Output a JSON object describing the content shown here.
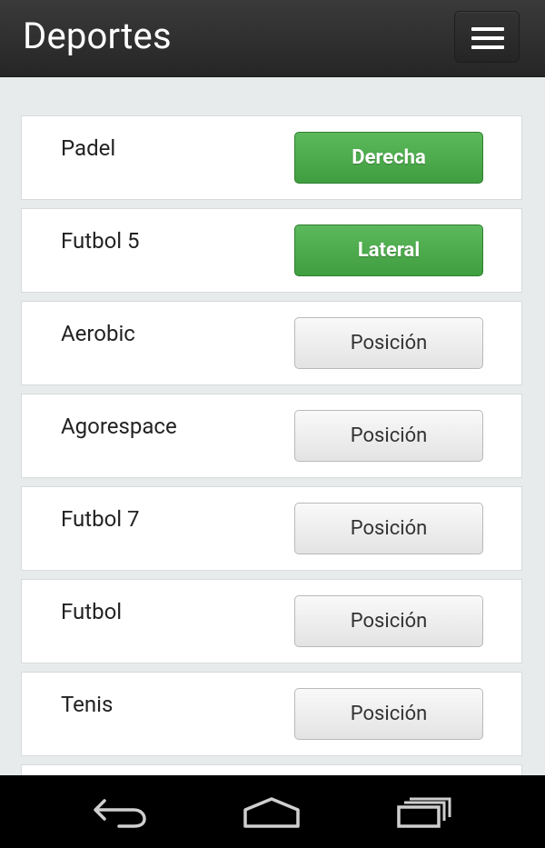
{
  "app_bar": {
    "title": "Deportes",
    "menu_icon": "hamburger-menu-icon"
  },
  "sports": [
    {
      "name": "Padel",
      "button_label": "Derecha",
      "state": "selected"
    },
    {
      "name": "Futbol 5",
      "button_label": "Lateral",
      "state": "selected"
    },
    {
      "name": "Aerobic",
      "button_label": "Posición",
      "state": "unset"
    },
    {
      "name": "Agorespace",
      "button_label": "Posición",
      "state": "unset"
    },
    {
      "name": "Futbol 7",
      "button_label": "Posición",
      "state": "unset"
    },
    {
      "name": "Futbol",
      "button_label": "Posición",
      "state": "unset"
    },
    {
      "name": "Tenis",
      "button_label": "Posición",
      "state": "unset"
    }
  ],
  "colors": {
    "selected_button": "#4cae4c",
    "header_background": "#2d2d2d",
    "page_background": "#e8ebeb"
  },
  "nav_bar": {
    "back_icon": "back-icon",
    "home_icon": "home-icon",
    "recents_icon": "recent-apps-icon"
  }
}
